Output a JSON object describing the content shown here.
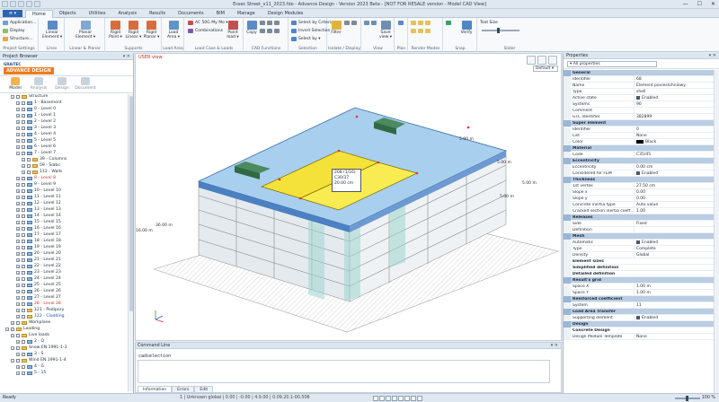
{
  "window": {
    "title": "Essec Street_v11_2023.fdo - Advance Design - Version 2023 Beta - [NOT FOR RESALE version - Model CAD View]",
    "min": "—",
    "max": "☐",
    "close": "✕"
  },
  "ribbon": {
    "file_tab": "≡ ▾",
    "tabs": [
      "Home",
      "Objects",
      "Utilities",
      "Analysis",
      "Results",
      "Documents",
      "BIM",
      "Manage",
      "Design Modules"
    ],
    "project_settings": {
      "label": "Project Settings",
      "items": [
        "Application...",
        "Display",
        "Structure..."
      ]
    },
    "lines": {
      "label": "Lines",
      "items": [
        "Linear Element ▾"
      ]
    },
    "planar": {
      "label": "Linear & Planar",
      "items": [
        "Planar Element ▾"
      ]
    },
    "supports": {
      "label": "Supports",
      "items": [
        "Rigid Point ▾",
        "Rigid Linear ▾",
        "Rigid Planar ▾"
      ]
    },
    "load_area": {
      "label": "Load Area",
      "items": [
        "Load Area ▾"
      ]
    },
    "load_case": {
      "label": "Load Case & Loads",
      "items": [
        "AC 50G My Mo ▾",
        "Combinations"
      ],
      "point_load": "Point load ▾"
    },
    "cad_functions": {
      "label": "CAD Functions",
      "items": [
        "Copy"
      ]
    },
    "selection": {
      "label": "Selection",
      "items": [
        "Select by Criteria",
        "Invert Selection",
        "Select by ▾"
      ]
    },
    "isolate": {
      "label": "Isolate / Display",
      "items": [
        "Filter"
      ]
    },
    "view": {
      "label": "View",
      "items": [
        "Save view ▾"
      ]
    },
    "plan": {
      "label": "Plan"
    },
    "render": {
      "label": "Render Modes"
    },
    "snap": {
      "label": "Snap",
      "items": [
        "Verify"
      ]
    },
    "slider": {
      "label": "Slider",
      "text_size": "Text Size",
      "level": 0.42
    }
  },
  "left_panel": {
    "title": "Project Browser",
    "controls": "▾ ✕",
    "brand_top": "GRAITEC",
    "brand_main": "ADVANCE DESIGN",
    "modes": [
      "Model",
      "Analysis",
      "Design",
      "Document"
    ],
    "tree": [
      {
        "label": "Structure",
        "level": 2,
        "kind": "folder",
        "exp": "−"
      },
      {
        "label": "1 - Basement",
        "level": 3,
        "kind": "level",
        "exp": "+"
      },
      {
        "label": "0 - Level 0",
        "level": 3,
        "kind": "level",
        "exp": "+"
      },
      {
        "label": "1 - Level 1",
        "level": 3,
        "kind": "level",
        "exp": "+"
      },
      {
        "label": "2 - Level 2",
        "level": 3,
        "kind": "level",
        "exp": "+"
      },
      {
        "label": "3 - Level 3",
        "level": 3,
        "kind": "level",
        "exp": "+"
      },
      {
        "label": "4 - Level 4",
        "level": 3,
        "kind": "level",
        "exp": "+"
      },
      {
        "label": "5 - Level 5",
        "level": 3,
        "kind": "level",
        "exp": "+"
      },
      {
        "label": "6 - Level 6",
        "level": 3,
        "kind": "level",
        "exp": "+"
      },
      {
        "label": "7 - Level 7",
        "level": 3,
        "kind": "level",
        "exp": "−"
      },
      {
        "label": "39 - Columns",
        "level": 4,
        "kind": "folder",
        "exp": "+"
      },
      {
        "label": "59 - Slabs",
        "level": 4,
        "kind": "folder",
        "exp": "+"
      },
      {
        "label": "112 - Walls",
        "level": 4,
        "kind": "folder",
        "exp": "+"
      },
      {
        "label": "8 - Level 8",
        "level": 3,
        "kind": "level",
        "exp": "+",
        "color": "#c0392b"
      },
      {
        "label": "9 - Level 9",
        "level": 3,
        "kind": "level",
        "exp": "+"
      },
      {
        "label": "10 - Level 10",
        "level": 3,
        "kind": "level",
        "exp": "+"
      },
      {
        "label": "11 - Level 11",
        "level": 3,
        "kind": "level",
        "exp": "+"
      },
      {
        "label": "12 - Level 12",
        "level": 3,
        "kind": "level",
        "exp": "+"
      },
      {
        "label": "13 - Level 13",
        "level": 3,
        "kind": "level",
        "exp": "+"
      },
      {
        "label": "14 - Level 14",
        "level": 3,
        "kind": "level",
        "exp": "+"
      },
      {
        "label": "15 - Level 15",
        "level": 3,
        "kind": "level",
        "exp": "+"
      },
      {
        "label": "16 - Level 16",
        "level": 3,
        "kind": "level",
        "exp": "+"
      },
      {
        "label": "17 - Level 17",
        "level": 3,
        "kind": "level",
        "exp": "+"
      },
      {
        "label": "18 - Level 18",
        "level": 3,
        "kind": "level",
        "exp": "+"
      },
      {
        "label": "19 - Level 19",
        "level": 3,
        "kind": "level",
        "exp": "+"
      },
      {
        "label": "20 - Level 20",
        "level": 3,
        "kind": "level",
        "exp": "+"
      },
      {
        "label": "21 - Level 21",
        "level": 3,
        "kind": "level",
        "exp": "+"
      },
      {
        "label": "22 - Level 22",
        "level": 3,
        "kind": "level",
        "exp": "+"
      },
      {
        "label": "23 - Level 23",
        "level": 3,
        "kind": "level",
        "exp": "+"
      },
      {
        "label": "24 - Level 24",
        "level": 3,
        "kind": "level",
        "exp": "+"
      },
      {
        "label": "25 - Level 25",
        "level": 3,
        "kind": "level",
        "exp": "+"
      },
      {
        "label": "26 - Level 26",
        "level": 3,
        "kind": "level",
        "exp": "+"
      },
      {
        "label": "27 - Level 27",
        "level": 3,
        "kind": "level",
        "exp": "+"
      },
      {
        "label": "28 - Level 28",
        "level": 3,
        "kind": "level",
        "exp": "+",
        "color": "#c0392b"
      },
      {
        "label": "121 - Podipory",
        "level": 3,
        "kind": "folder",
        "exp": "+"
      },
      {
        "label": "122 - Cladding",
        "level": 3,
        "kind": "folder",
        "exp": "+",
        "color": "#1f4fbf"
      },
      {
        "label": "Workplane",
        "level": 2,
        "kind": "folder",
        "exp": "+"
      },
      {
        "label": "Loading",
        "level": 1,
        "kind": "folder",
        "exp": "−"
      },
      {
        "label": "Live loads",
        "level": 2,
        "kind": "folder",
        "exp": "−"
      },
      {
        "label": "2 - Q",
        "level": 3,
        "kind": "level",
        "exp": "+"
      },
      {
        "label": "Snow EN 1991-1-3",
        "level": 2,
        "kind": "folder",
        "exp": "−"
      },
      {
        "label": "3 - S",
        "level": 3,
        "kind": "level",
        "exp": "+"
      },
      {
        "label": "Wind EN 1991-1-4",
        "level": 2,
        "kind": "folder",
        "exp": "−"
      },
      {
        "label": "4 - G",
        "level": 3,
        "kind": "level",
        "exp": "+"
      },
      {
        "label": "5 - 15",
        "level": 3,
        "kind": "level",
        "exp": "+"
      }
    ]
  },
  "viewport": {
    "label": "USER view",
    "view_select": "Default ▾",
    "dims": [
      "5.00 m",
      "5.00 m",
      "5.00 m",
      "36.00 m",
      "16.00 m",
      "5.00 m"
    ],
    "tooltip": [
      "208 (1/16)",
      "C30/37",
      "20.00 cm"
    ]
  },
  "command": {
    "title": "Command Line",
    "controls": "▾ ✕",
    "text": "cadselection",
    "tabs": [
      "Information",
      "Errors",
      "Edit"
    ]
  },
  "properties": {
    "title": "Properties",
    "controls": "▾ ✕",
    "filter": "▾ All properties",
    "rows": [
      {
        "k": "General",
        "t": "sec"
      },
      {
        "k": "Identifier",
        "v": "68"
      },
      {
        "k": "Name",
        "v": "Element poviestchniowy"
      },
      {
        "k": "Type",
        "v": "shell"
      },
      {
        "k": "Active state",
        "v": "Enabled",
        "cb": true
      },
      {
        "k": "Systems",
        "v": "90"
      },
      {
        "k": "Comment",
        "v": ""
      },
      {
        "k": "GTC Identifier",
        "v": "382899"
      },
      {
        "k": "Super element",
        "t": "sec"
      },
      {
        "k": "Identifier",
        "v": "0"
      },
      {
        "k": "List",
        "v": "None"
      },
      {
        "k": "Color",
        "v": "Black",
        "sw": true
      },
      {
        "k": "Material",
        "t": "sec"
      },
      {
        "k": "Code",
        "v": "C35/45"
      },
      {
        "k": "Eccentricity",
        "t": "sec"
      },
      {
        "k": "Eccentricity",
        "v": "0.00 cm"
      },
      {
        "k": "Considered for FEM",
        "v": "Enabled",
        "cb": true
      },
      {
        "k": "Thickness",
        "t": "sec"
      },
      {
        "k": "1st vertex",
        "v": "27.50 cm"
      },
      {
        "k": "Slope x",
        "v": "0.00"
      },
      {
        "k": "Slope y",
        "v": "0.00"
      },
      {
        "k": "Concrete inertia type",
        "v": "Auto value"
      },
      {
        "k": "Cracked section inertia coeff...",
        "v": "1.00"
      },
      {
        "k": "Releases",
        "t": "sec"
      },
      {
        "k": "Side",
        "v": "Fixed"
      },
      {
        "k": "Definition",
        "v": ""
      },
      {
        "k": "Mesh",
        "t": "sec"
      },
      {
        "k": "Automatic",
        "v": "Enabled",
        "cb": true
      },
      {
        "k": "Type",
        "v": "Complete"
      },
      {
        "k": "Density",
        "v": "Global"
      },
      {
        "k": "Element sizes",
        "t": "sub"
      },
      {
        "k": "Simplified definition",
        "t": "sub"
      },
      {
        "k": "Detailed definition",
        "t": "sub"
      },
      {
        "k": "Result's grid",
        "t": "sec"
      },
      {
        "k": "Space X",
        "v": "1.00 m"
      },
      {
        "k": "Space Y",
        "v": "1.00 m"
      },
      {
        "k": "Reinforced coefficient",
        "t": "sec"
      },
      {
        "k": "System",
        "v": "11"
      },
      {
        "k": "Load Area Transfer",
        "t": "sec"
      },
      {
        "k": "Supporting element",
        "v": "Enabled",
        "cb": true
      },
      {
        "k": "Design",
        "t": "sec"
      },
      {
        "k": "Concrete Design",
        "t": "sub"
      },
      {
        "k": "Design Module Template",
        "v": "None"
      }
    ]
  },
  "status": {
    "ready": "Ready",
    "mid": "1 | Unknown global | 0.00 | -0.00 | 4.9.00 | 0.09.20.1-00.508",
    "zoom": "100 %"
  }
}
